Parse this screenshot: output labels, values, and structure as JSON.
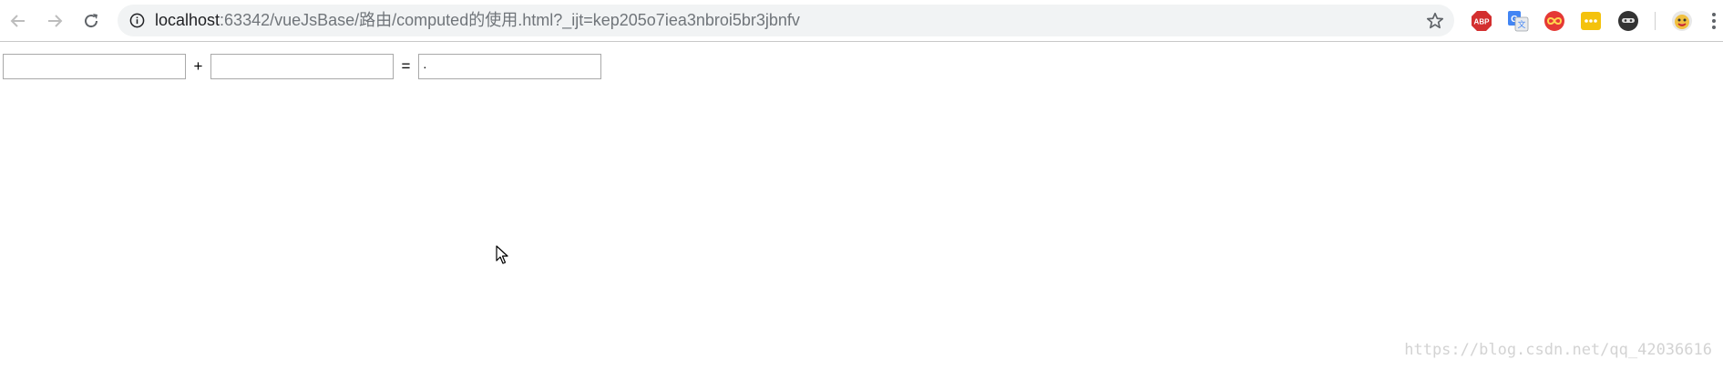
{
  "browser": {
    "url": {
      "host": "localhost",
      "rest": ":63342/vueJsBase/路由/computed的使用.html?_ijt=kep205o7iea3nbroi5br3jbnfv"
    },
    "extensions": [
      {
        "name": "adblock-plus-icon",
        "label": "ABP",
        "color": "#d32f2f"
      },
      {
        "name": "google-translate-icon",
        "color": "#4285f4"
      },
      {
        "name": "infinity-icon",
        "color": "#e53935"
      },
      {
        "name": "yellow-extension-icon",
        "color": "#f4c20d"
      },
      {
        "name": "ninja-icon",
        "color": "#333333"
      },
      {
        "name": "avatar-icon",
        "color": "#f0c040"
      }
    ]
  },
  "calculator": {
    "operand_a": "",
    "plus_sign": "+",
    "operand_b": "",
    "equals_sign": "=",
    "result": "·"
  },
  "watermark": {
    "text": "https://blog.csdn.net/qq_42036616"
  }
}
